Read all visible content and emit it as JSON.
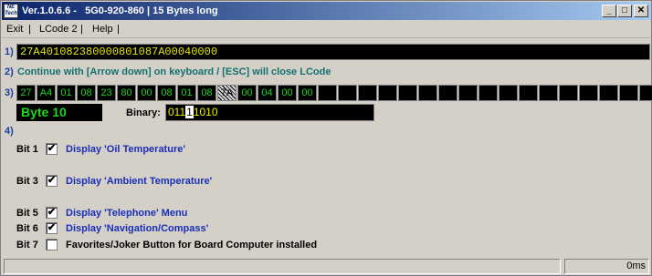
{
  "window": {
    "title": "Ver.1.0.6.6 -   5G0-920-860 | 15 Bytes long",
    "icon_text": "NE Tech",
    "buttons": {
      "minimize": "_",
      "maximize": "□",
      "close": "✕"
    }
  },
  "menu": {
    "items": [
      {
        "label": "Exit"
      },
      {
        "label": "LCode 2"
      },
      {
        "label": "Help"
      }
    ],
    "separator": "|"
  },
  "steps": {
    "step1": "1)",
    "step2": "2)",
    "step2_text": "Continue with [Arrow down] on keyboard / [ESC] will close LCode",
    "step3": "3)",
    "step4": "4)"
  },
  "coding": {
    "long_code": "27A401082380000801087A00040000"
  },
  "bytes": {
    "values": [
      "27",
      "A4",
      "01",
      "08",
      "23",
      "80",
      "00",
      "08",
      "01",
      "08",
      "7A",
      "00",
      "04",
      "00",
      "00",
      "",
      "",
      "",
      "",
      "",
      "",
      "",
      "",
      "",
      "",
      "",
      "",
      "",
      "",
      "",
      "",
      ""
    ],
    "selected_index": 10,
    "selected_label": "Byte 10",
    "binary_label": "Binary:",
    "binary_before": "011",
    "binary_cursor": "1",
    "binary_after": "1010"
  },
  "bits": [
    {
      "label": "Bit 1",
      "checked": true,
      "desc": "Display 'Oil Temperature'",
      "color": "#1a2fb8"
    },
    {
      "label": "Bit 3",
      "checked": true,
      "desc": "Display 'Ambient Temperature'",
      "color": "#1a2fb8"
    },
    {
      "label": "Bit 5",
      "checked": true,
      "desc": "Display 'Telephone' Menu",
      "color": "#1a2fb8"
    },
    {
      "label": "Bit 6",
      "checked": true,
      "desc": "Display 'Navigation/Compass'",
      "color": "#1a2fb8"
    },
    {
      "label": "Bit 7",
      "checked": false,
      "desc": "Favorites/Joker Button for Board Computer installed",
      "color": "#000000"
    }
  ],
  "status": {
    "left": "",
    "right": "0ms"
  }
}
